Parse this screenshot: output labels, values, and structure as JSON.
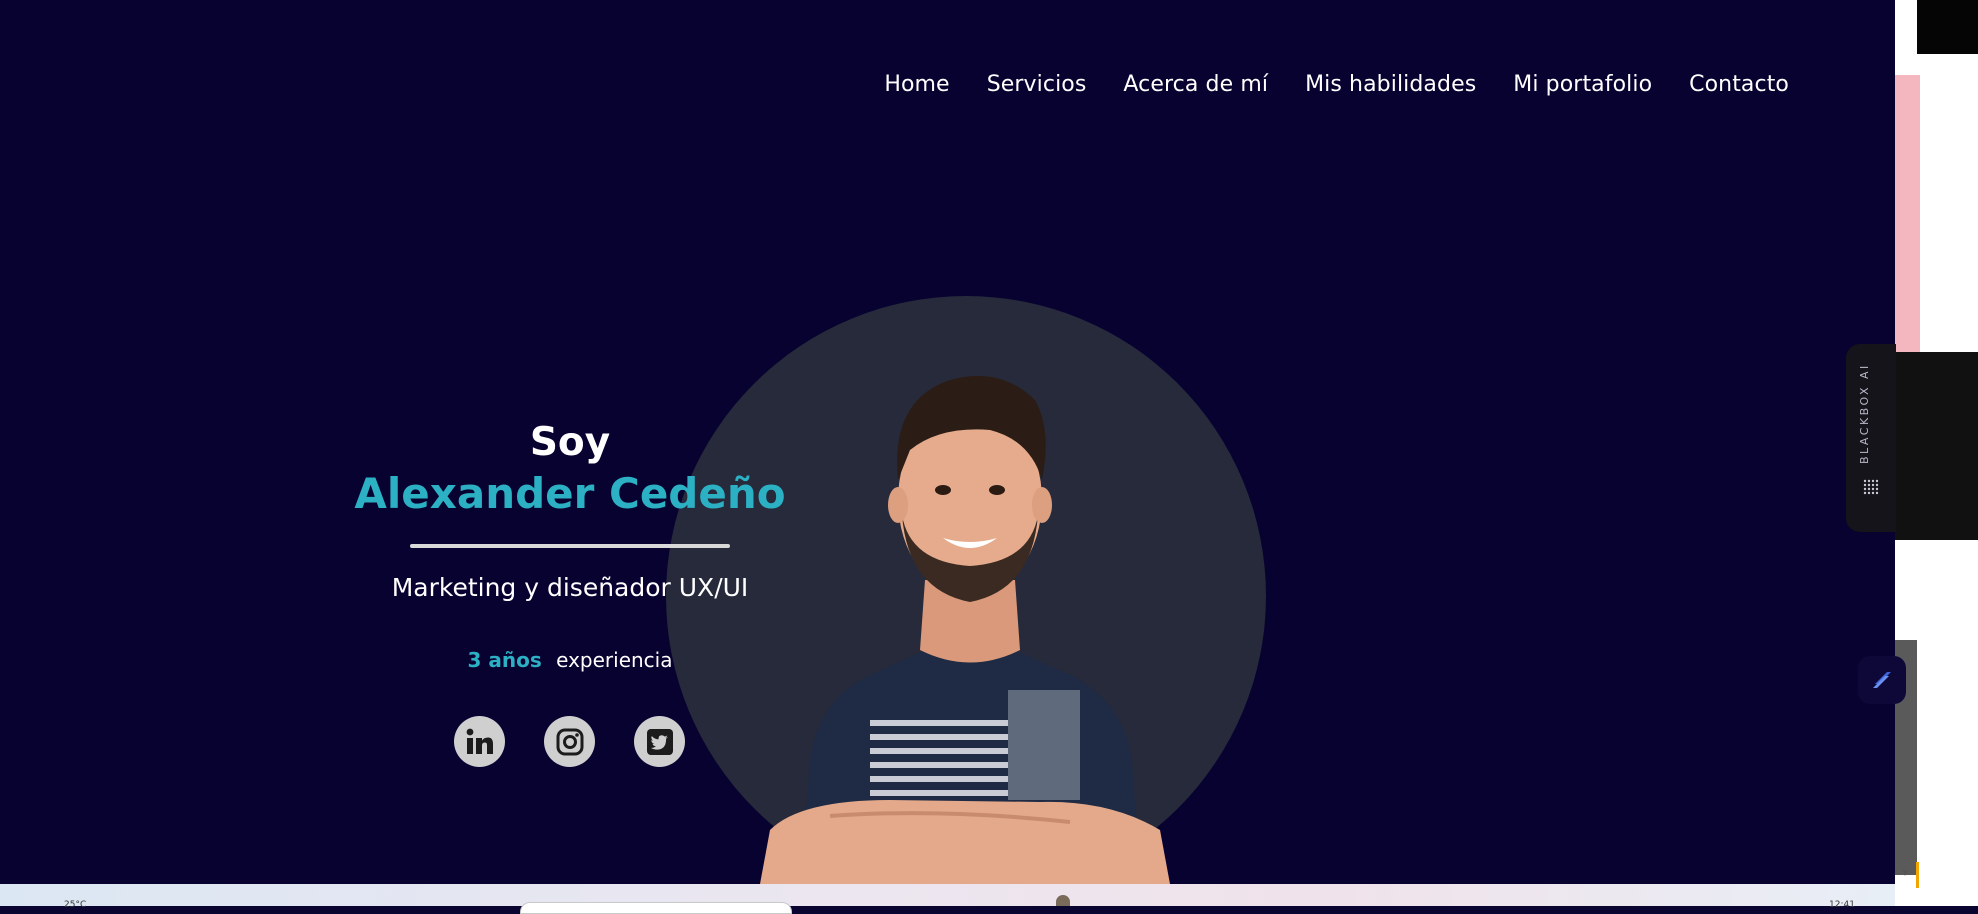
{
  "nav": {
    "items": [
      "Home",
      "Servicios",
      "Acerca de mí",
      "Mis habilidades",
      "Mi portafolio",
      "Contacto"
    ]
  },
  "hero": {
    "intro": "Soy",
    "name": "Alexander Cedeño",
    "role": "Marketing y diseñador UX/UI",
    "experience_value": "3 años",
    "experience_label": "experiencia"
  },
  "socials": [
    {
      "icon": "linkedin-icon"
    },
    {
      "icon": "instagram-icon"
    },
    {
      "icon": "twitter-icon"
    }
  ],
  "extension": {
    "label": "BLACKBOX AI"
  },
  "taskbar": {
    "left_text": "25°C",
    "right_text": "12:41"
  },
  "colors": {
    "background": "#080230",
    "accent": "#2cb0c4",
    "circle": "#262a3b",
    "social_bg": "#cfcfcf"
  }
}
